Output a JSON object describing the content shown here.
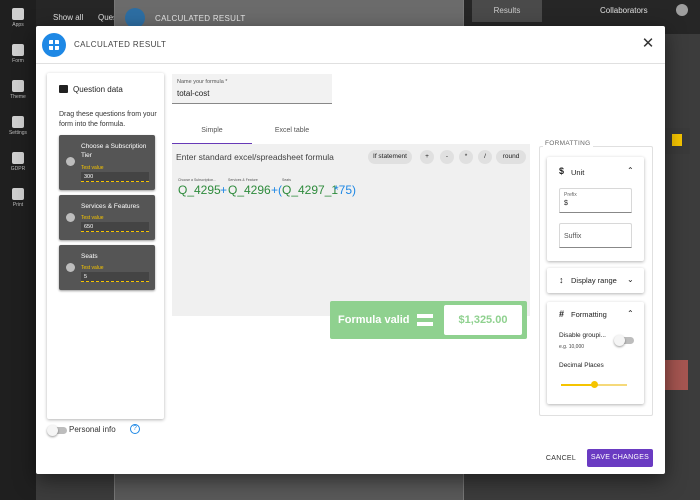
{
  "app": {
    "rail": [
      {
        "label": "Apps"
      },
      {
        "label": "Form"
      },
      {
        "label": "Theme"
      },
      {
        "label": "Settings"
      },
      {
        "label": "GDPR"
      },
      {
        "label": "Print"
      }
    ],
    "top_tabs": [
      "Show all",
      "Ques"
    ],
    "results_tab": "Results",
    "collaborators": "Collaborators"
  },
  "background_panel": {
    "title": "CALCULATED RESULT"
  },
  "modal": {
    "title": "CALCULATED RESULT",
    "close_icon": "close-icon",
    "questions": {
      "heading": "Question data",
      "help": "Drag these questions from your form into the formula.",
      "items": [
        {
          "label": "Choose a Subscription Tier",
          "test_label": "Test value",
          "test_value": "300"
        },
        {
          "label": "Services & Features",
          "test_label": "Test value",
          "test_value": "650"
        },
        {
          "label": "Seats",
          "test_label": "Test value",
          "test_value": "5"
        }
      ]
    },
    "personal_info": "Personal info",
    "name_field": {
      "label": "Name your formula *",
      "value": "total-cost"
    },
    "tabs": [
      {
        "label": "Simple",
        "active": true
      },
      {
        "label": "Excel table",
        "active": false
      }
    ],
    "formula": {
      "placeholder": "Enter standard excel/spreadsheet formula",
      "operators": [
        "If statement",
        "+",
        "-",
        "*",
        "/",
        "round"
      ],
      "tokens": [
        {
          "caption": "Choose a Subscription...",
          "text": "Q_4295"
        },
        {
          "caption": "Services & Feature",
          "text": "Q_4296"
        },
        {
          "caption": "Seats",
          "text": "Q_4297_1"
        }
      ],
      "ops": [
        "+",
        "+(",
        "*75)"
      ]
    },
    "validation": {
      "label": "Formula valid",
      "result": "$1,325.00",
      "color": "#8fd18f"
    },
    "formatting": {
      "legend": "FORMATTING",
      "unit": {
        "title": "Unit",
        "prefix_label": "Prefix",
        "prefix_value": "$",
        "suffix_placeholder": "Suffix"
      },
      "display_range": {
        "title": "Display range"
      },
      "fmt": {
        "title": "Formatting",
        "grouping_label": "Disable groupi...",
        "grouping_hint": "e.g. 10,000",
        "decimal_label": "Decimal Places",
        "decimal_value_fraction": 0.5
      }
    },
    "footer": {
      "cancel": "CANCEL",
      "save": "SAVE CHANGES"
    },
    "accent": "#6a3bc2"
  }
}
